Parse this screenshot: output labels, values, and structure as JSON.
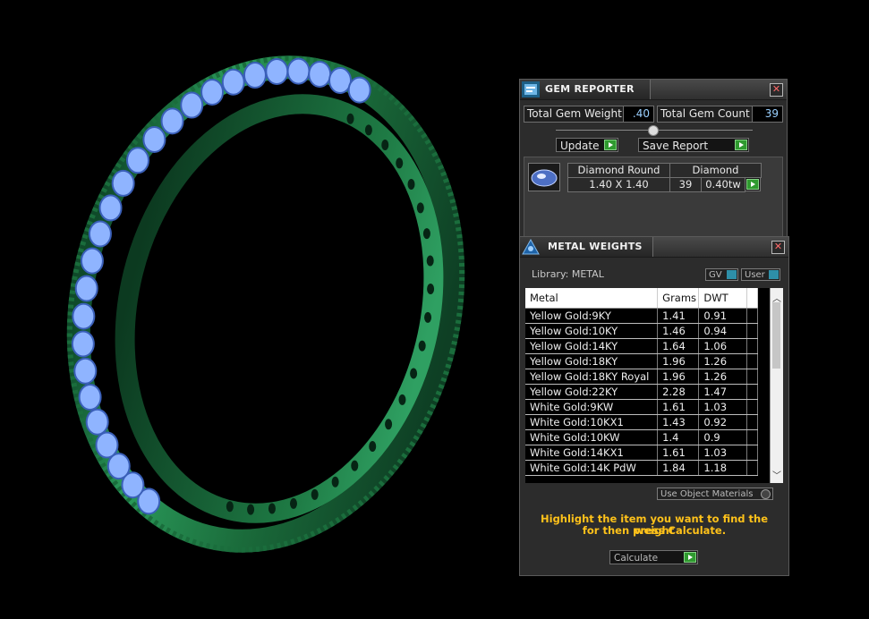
{
  "gem_reporter": {
    "title": "GEM REPORTER",
    "close_glyph": "✕",
    "total_gem_weight_label": "Total Gem Weight",
    "total_gem_weight_value": ".40",
    "total_gem_count_label": "Total Gem Count",
    "total_gem_count_value": "39",
    "update_label": "Update",
    "save_report_label": "Save Report",
    "gem_row": {
      "shape": "Diamond Round",
      "material": "Diamond",
      "size": "1.40 X 1.40",
      "count": "39",
      "weight": "0.40tw"
    }
  },
  "metal_weights": {
    "title": "METAL WEIGHTS",
    "close_glyph": "✕",
    "library_label": "Library: METAL",
    "gv_label": "GV",
    "user_label": "User",
    "columns": [
      "Metal",
      "Grams",
      "DWT"
    ],
    "rows": [
      {
        "metal": "Yellow Gold:9KY",
        "grams": "1.41",
        "dwt": "0.91"
      },
      {
        "metal": "Yellow Gold:10KY",
        "grams": "1.46",
        "dwt": "0.94"
      },
      {
        "metal": "Yellow Gold:14KY",
        "grams": "1.64",
        "dwt": "1.06"
      },
      {
        "metal": "Yellow Gold:18KY",
        "grams": "1.96",
        "dwt": "1.26"
      },
      {
        "metal": "Yellow Gold:18KY Royal",
        "grams": "1.96",
        "dwt": "1.26"
      },
      {
        "metal": "Yellow Gold:22KY",
        "grams": "2.28",
        "dwt": "1.47"
      },
      {
        "metal": "White Gold:9KW",
        "grams": "1.61",
        "dwt": "1.03"
      },
      {
        "metal": "White Gold:10KX1",
        "grams": "1.43",
        "dwt": "0.92"
      },
      {
        "metal": "White Gold:10KW",
        "grams": "1.4",
        "dwt": "0.9"
      },
      {
        "metal": "White Gold:14KX1",
        "grams": "1.61",
        "dwt": "1.03"
      },
      {
        "metal": "White Gold:14K PdW",
        "grams": "1.84",
        "dwt": "1.18"
      }
    ],
    "use_object_materials_label": "Use Object Materials",
    "message_line1": "Highlight the item you want to find the weight",
    "message_line2": "for then press Calculate.",
    "calculate_label": "Calculate"
  },
  "colors": {
    "ring_green": "#1f7a45",
    "gem_blue": "#8fb4ff",
    "message_yellow": "#ffc21a",
    "go_green": "#2f9a2f"
  }
}
